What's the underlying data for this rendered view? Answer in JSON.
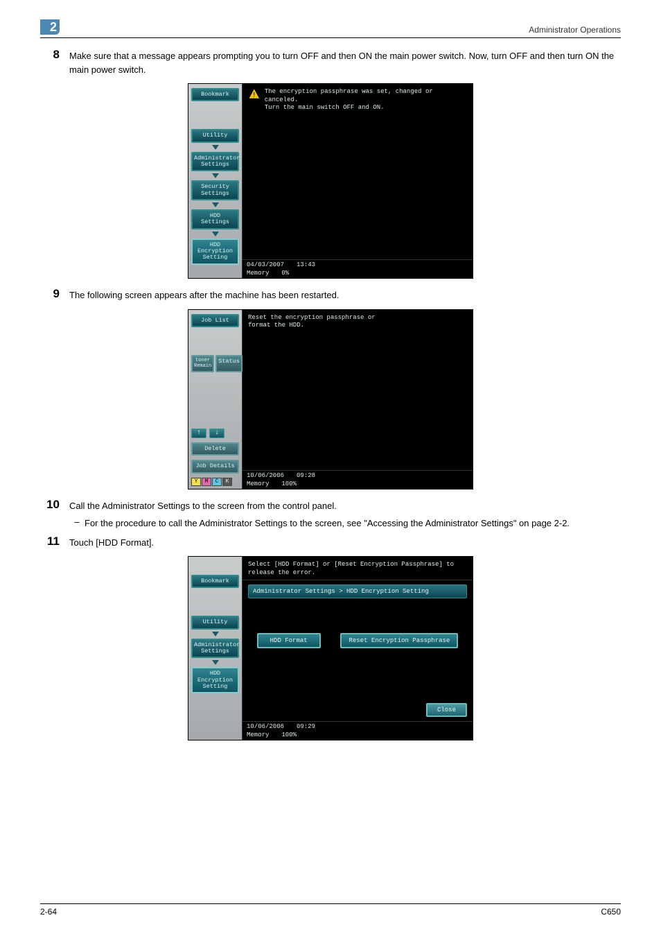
{
  "header": {
    "chapter_number": "2",
    "title": "Administrator Operations"
  },
  "footer": {
    "page": "2-64",
    "model": "C650"
  },
  "step8": {
    "num": "8",
    "text": "Make sure that a message appears prompting you to turn OFF and then ON the main power switch. Now, turn OFF and then turn ON the main power switch."
  },
  "step9": {
    "num": "9",
    "text": "The following screen appears after the machine has been restarted."
  },
  "step10": {
    "num": "10",
    "text": "Call the Administrator Settings to the screen from the control panel.",
    "sub_dash": "–",
    "sub_text": "For the procedure to call the Administrator Settings to the screen, see \"Accessing the Administrator Settings\" on page 2-2."
  },
  "step11": {
    "num": "11",
    "text": "Touch [HDD Format]."
  },
  "panel1": {
    "side": {
      "bookmark": "Bookmark",
      "utility": "Utility",
      "admin": "Administrator\nSettings",
      "security": "Security\nSettings",
      "hdd_settings": "HDD Settings",
      "hdd_enc": "HDD Encryption\nSetting"
    },
    "msg_line1": "The encryption passphrase was set, changed or canceled.",
    "msg_line2": "Turn the main switch OFF and ON.",
    "status": {
      "date": "04/03/2007",
      "time": "13:43",
      "mem_label": "Memory",
      "mem_val": "0%"
    }
  },
  "panel2": {
    "side": {
      "joblist": "Job List",
      "toner_label": "toner\nRemain",
      "status": "Status",
      "delete": "Delete",
      "jobdetails": "Job Details",
      "arrow_up": "↑",
      "arrow_down": "↓",
      "toner": {
        "y": "Y",
        "m": "M",
        "c": "C",
        "k": "K"
      }
    },
    "msg_line1": "Reset the encryption passphrase or",
    "msg_line2": "format the HDD.",
    "status": {
      "date": "10/06/2006",
      "time": "09:28",
      "mem_label": "Memory",
      "mem_val": "100%"
    }
  },
  "panel3": {
    "side": {
      "bookmark": "Bookmark",
      "utility": "Utility",
      "admin": "Administrator\nSettings",
      "hdd_enc": "HDD Encryption\nSetting"
    },
    "headline": "Select [HDD Format] or [Reset Encryption Passphrase] to release the error.",
    "crumb": "Administrator Settings > HDD Encryption Setting",
    "btn_format": "HDD Format",
    "btn_reset": "Reset Encryption Passphrase",
    "btn_close": "Close",
    "status": {
      "date": "10/06/2006",
      "time": "09:29",
      "mem_label": "Memory",
      "mem_val": "100%"
    }
  }
}
